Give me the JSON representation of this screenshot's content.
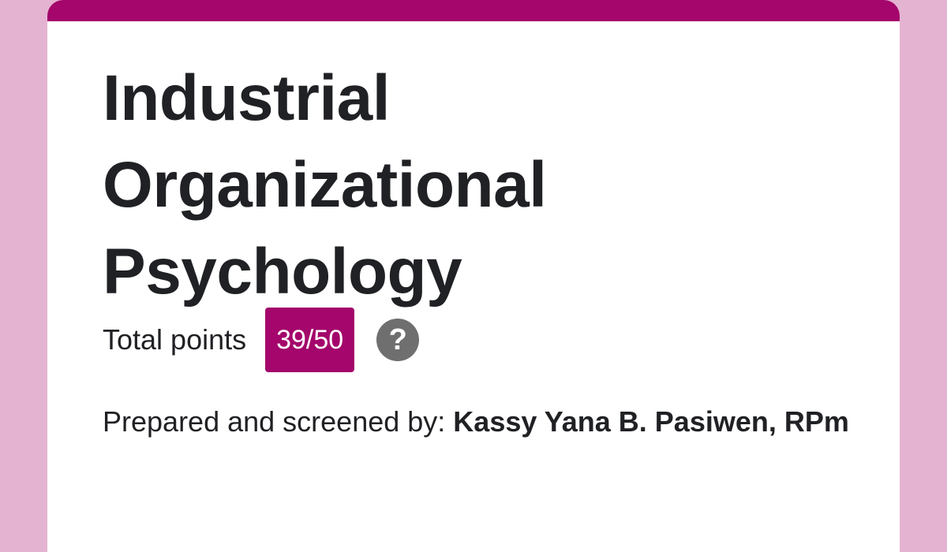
{
  "colors": {
    "background": "#e4b3d1",
    "accent": "#a4066b",
    "card": "#ffffff",
    "text": "#202124",
    "help_icon": "#6f6f6f"
  },
  "form": {
    "title_lines": [
      "Industrial",
      "Organizational",
      "Psychology"
    ],
    "points_label": "Total points",
    "score": "39/50",
    "help_icon": "question-mark-icon",
    "help_glyph": "?",
    "prepared_prefix": "Prepared and screened by: ",
    "prepared_author": "Kassy Yana B. Pasiwen, RPm"
  }
}
